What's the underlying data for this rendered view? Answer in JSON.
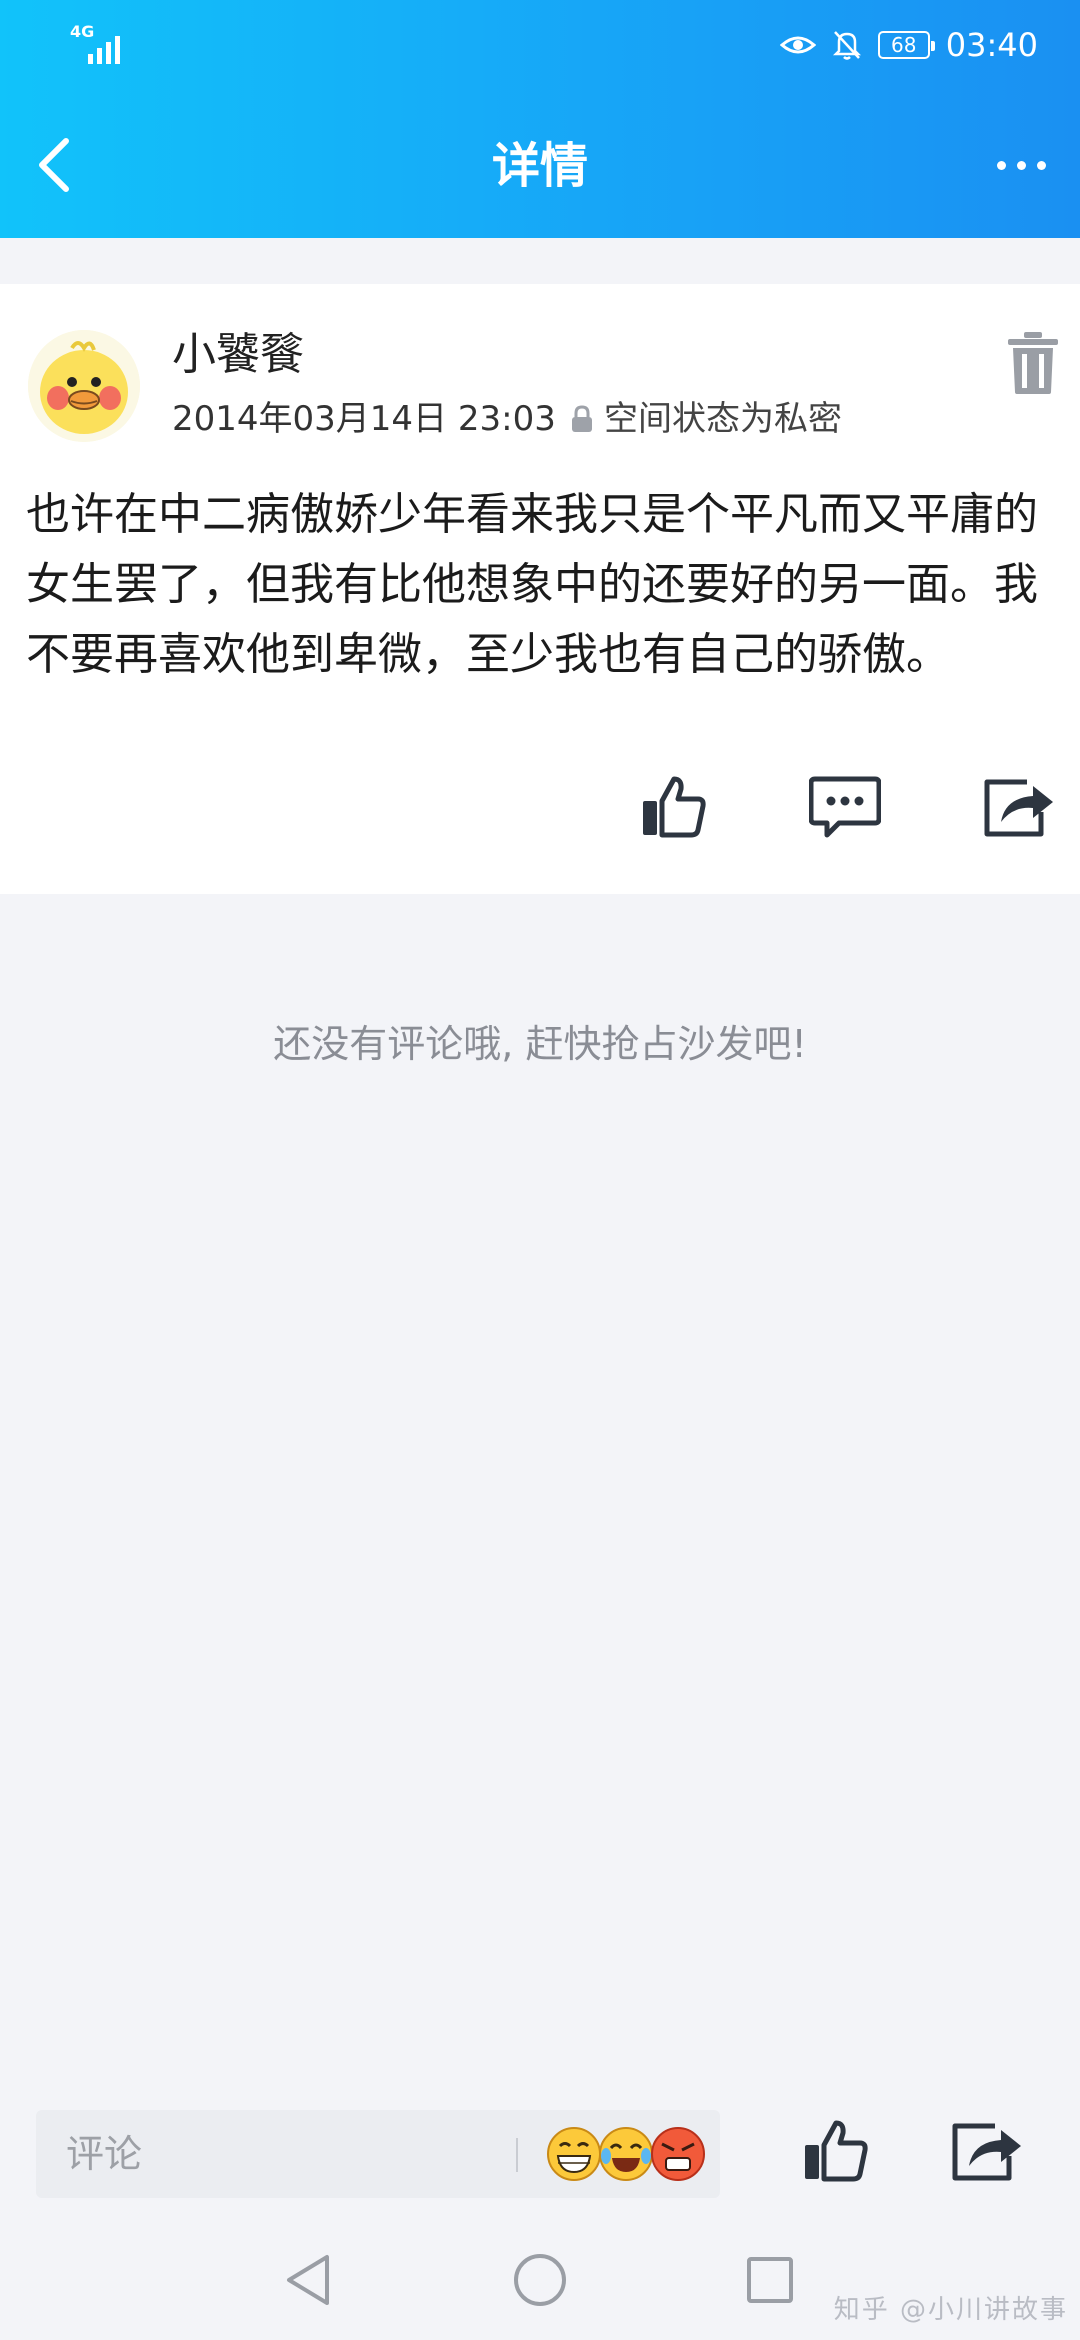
{
  "status_bar": {
    "network": "4G",
    "battery": "68",
    "time": "03:40"
  },
  "header": {
    "title": "详情"
  },
  "post": {
    "author": "小饕餮",
    "time": "2014年03月14日 23:03",
    "privacy": "空间状态为私密",
    "content": "也许在中二病傲娇少年看来我只是个平凡而又平庸的女生罢了，但我有比他想象中的还要好的另一面。我不要再喜欢他到卑微，至少我也有自己的骄傲。"
  },
  "comments": {
    "empty_text": "还没有评论哦, 赶快抢占沙发吧!"
  },
  "composer": {
    "placeholder": "评论"
  },
  "watermark": "知乎 @小川讲故事",
  "icons": {
    "back": "chevron-left-icon",
    "more": "more-dots-icon",
    "delete": "trash-icon",
    "lock": "lock-icon",
    "like": "thumbs-up-icon",
    "comment": "comment-bubble-icon",
    "share": "share-arrow-icon"
  },
  "colors": {
    "header_start": "#11c3fa",
    "header_end": "#1a90f2",
    "icon": "#2d3540"
  }
}
